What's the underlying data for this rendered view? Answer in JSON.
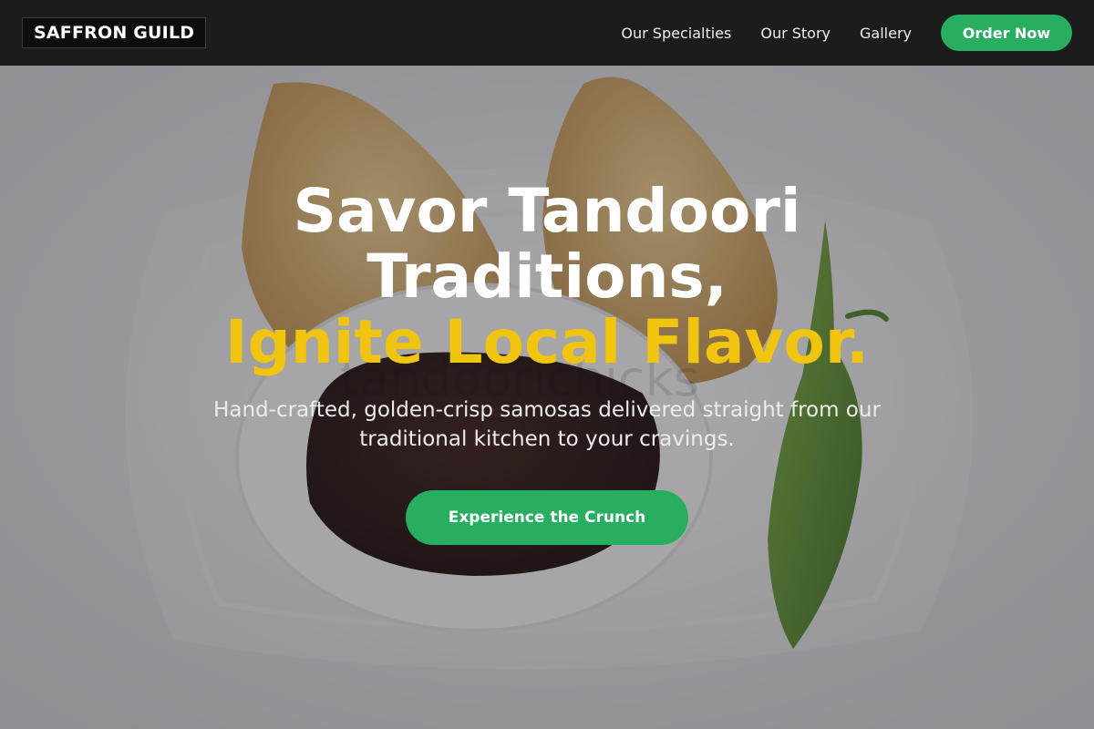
{
  "header": {
    "logo": "SAFFRON GUILD",
    "nav": [
      {
        "label": "Our Specialties"
      },
      {
        "label": "Our Story"
      },
      {
        "label": "Gallery"
      }
    ],
    "order_label": "Order Now"
  },
  "hero": {
    "headline_line1": "Savor Tandoori",
    "headline_line2": "Traditions,",
    "headline_accent": "Ignite Local Flavor.",
    "subtext": "Hand-crafted, golden-crisp samosas delivered straight from our traditional kitchen to your cravings.",
    "cta_label": "Experience the Crunch",
    "watermark": "tandoorichicks"
  },
  "colors": {
    "nav_bg": "#1c1c1c",
    "accent_green": "#27ae60",
    "accent_gold": "#f1c40f"
  }
}
